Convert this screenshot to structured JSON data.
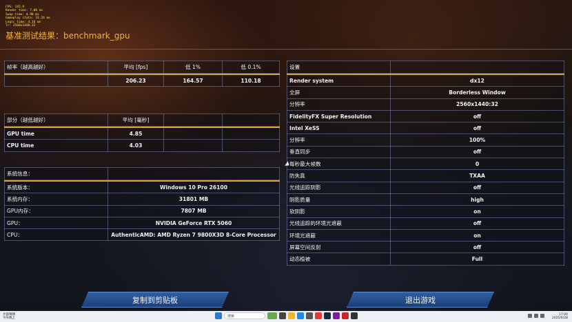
{
  "overlay": {
    "lines": [
      "FPS: 145.9",
      "Render time: 7.06 ms",
      "Swap time: 4.90 ms",
      "Gameplay state: 33.24 ms",
      "Logic time: 4.16 ms",
      "Tr: 2560x1440:32"
    ]
  },
  "title": "基准测试结果：benchmark_gpu",
  "fps_table": {
    "headers": [
      "帧率（越高越好）",
      "平均 [fps]",
      "低 1%",
      "低 0.1%"
    ],
    "row": [
      "",
      "206.23",
      "164.57",
      "110.18"
    ]
  },
  "part_table": {
    "headers": [
      "部分（越低越好）",
      "平均 [毫秒]"
    ],
    "rows": [
      {
        "label": "GPU time",
        "value": "4.85"
      },
      {
        "label": "CPU time",
        "value": "4.03"
      }
    ]
  },
  "sys_table": {
    "header": "系统信息：",
    "rows": [
      {
        "label": "系统版本：",
        "value": "Windows 10 Pro 26100"
      },
      {
        "label": "系统内存：",
        "value": "31801 MB"
      },
      {
        "label": "GPU内存：",
        "value": "7807 MB"
      },
      {
        "label": "GPU：",
        "value": "NVIDIA GeForce RTX 5060"
      },
      {
        "label": "CPU：",
        "value": "AuthenticAMD: AMD Ryzen 7 9800X3D 8-Core Processor"
      }
    ]
  },
  "settings_table": {
    "header": "设置",
    "rows": [
      {
        "label": "Render system",
        "value": "dx12"
      },
      {
        "label": "全屏",
        "value": "Borderless Window"
      },
      {
        "label": "分辨率",
        "value": "2560x1440:32"
      },
      {
        "label": "FidelityFX Super Resolution",
        "value": "off"
      },
      {
        "label": "Intel XeSS",
        "value": "off"
      },
      {
        "label": "分辨率",
        "value": "100%"
      },
      {
        "label": "垂直同步",
        "value": "off"
      },
      {
        "label": "每秒最大帧数",
        "value": "0"
      },
      {
        "label": "防失真",
        "value": "TXAA"
      },
      {
        "label": "光线追踪阴影",
        "value": "off"
      },
      {
        "label": "阴影质量",
        "value": "high"
      },
      {
        "label": "软阴影",
        "value": "on"
      },
      {
        "label": "光线追踪的环境光遮蔽",
        "value": "off"
      },
      {
        "label": "环境光遮蔽",
        "value": "on"
      },
      {
        "label": "屏幕空间反射",
        "value": "off"
      },
      {
        "label": "动态植被",
        "value": "Full"
      }
    ]
  },
  "buttons": {
    "copy": "复制到剪贴板",
    "exit": "退出游戏"
  },
  "taskbar": {
    "weather_line1": "大部晴朗",
    "weather_line2": "今天晚上",
    "search_placeholder": "搜索",
    "time": "17:00",
    "date": "2025/6/28"
  }
}
